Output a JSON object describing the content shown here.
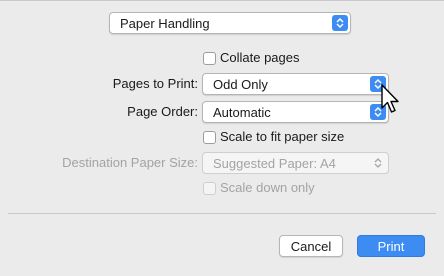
{
  "section_popup": {
    "value": "Paper Handling"
  },
  "collate": {
    "label": "Collate pages",
    "checked": false
  },
  "pages_to_print": {
    "label": "Pages to Print:",
    "value": "Odd Only"
  },
  "page_order": {
    "label": "Page Order:",
    "value": "Automatic"
  },
  "scale_to_fit": {
    "label": "Scale to fit paper size",
    "checked": false
  },
  "destination_paper_size": {
    "label": "Destination Paper Size:",
    "value": "Suggested Paper: A4",
    "enabled": false
  },
  "scale_down_only": {
    "label": "Scale down only",
    "checked": false,
    "enabled": false
  },
  "buttons": {
    "cancel": "Cancel",
    "print": "Print"
  },
  "colors": {
    "accent": "#3c8cf2",
    "background": "#ebebeb",
    "disabled_text": "#a3a3a3"
  },
  "icons": {
    "stepper": "up-down-chevron-icon",
    "pointer": "mouse-pointer-icon"
  }
}
